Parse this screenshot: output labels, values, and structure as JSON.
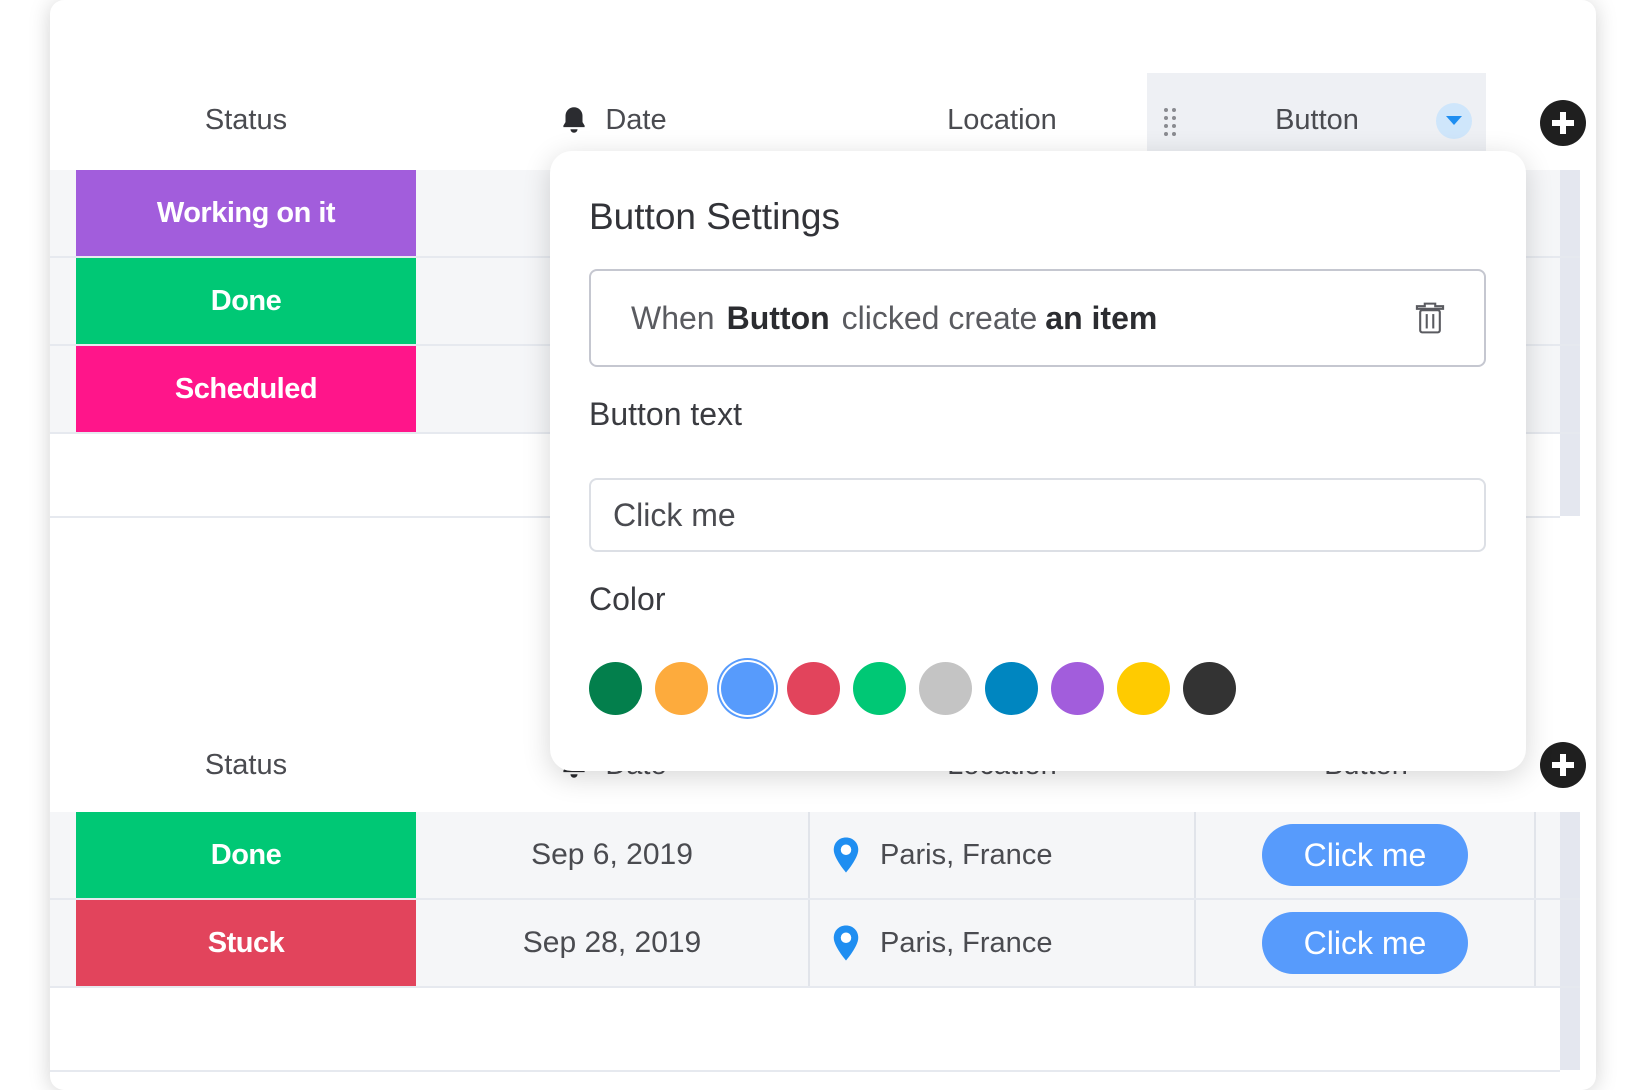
{
  "board": {
    "top_group": {
      "headers": {
        "status": "Status",
        "date": "Date",
        "location": "Location",
        "button": "Button"
      },
      "rows": [
        {
          "status": "Working on it",
          "status_color": "#a25ddc"
        },
        {
          "status": "Done",
          "status_color": "#00c875"
        },
        {
          "status": "Scheduled",
          "status_color": "#ff158a"
        }
      ]
    },
    "bottom_group": {
      "headers": {
        "status": "Status",
        "date": "Date",
        "location": "Location",
        "button": "Button"
      },
      "rows": [
        {
          "status": "Done",
          "status_color": "#00c875",
          "date": "Sep 6, 2019",
          "location": "Paris, France",
          "button": "Click me"
        },
        {
          "status": "Stuck",
          "status_color": "#e2445c",
          "date": "Sep 28, 2019",
          "location": "Paris, France",
          "button": "Click me"
        }
      ]
    },
    "icons": {
      "add_column": "plus-circle-icon",
      "date_header": "bell-icon",
      "location": "map-pin-icon",
      "drag": "drag-handle-icon",
      "dropdown": "chevron-down-icon",
      "delete": "trash-icon"
    }
  },
  "popover": {
    "title": "Button Settings",
    "rule": {
      "prefix": "When",
      "trigger": "Button",
      "middle": "clicked create",
      "action": "an item"
    },
    "button_text_label": "Button text",
    "button_text_value": "Click me",
    "color_label": "Color",
    "colors": [
      "#037f4c",
      "#fdab3d",
      "#579bfc",
      "#e2445c",
      "#00c875",
      "#c4c4c4",
      "#0086c0",
      "#a25ddc",
      "#ffcb00",
      "#333333"
    ],
    "selected_color": "#579bfc"
  },
  "accent_color": "#579bfc"
}
